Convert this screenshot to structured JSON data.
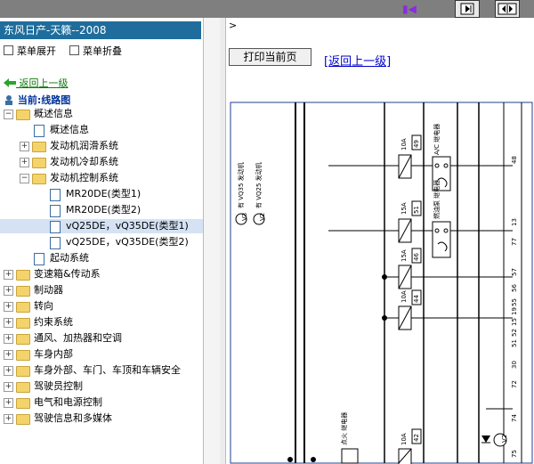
{
  "window": {
    "title": "东风日产-天籁--2008"
  },
  "menu": {
    "expand": "菜单展开",
    "collapse": "菜单折叠"
  },
  "nav": {
    "back": "返回上一级",
    "current": "当前:线路图"
  },
  "tree": [
    {
      "label": "概述信息",
      "indent": 0,
      "type": "folder",
      "expanded": true
    },
    {
      "label": "概述信息",
      "indent": 1,
      "type": "doc"
    },
    {
      "label": "发动机润滑系统",
      "indent": 1,
      "type": "folder"
    },
    {
      "label": "发动机冷却系统",
      "indent": 1,
      "type": "folder"
    },
    {
      "label": "发动机控制系统",
      "indent": 1,
      "type": "folder",
      "expanded": true
    },
    {
      "label": "MR20DE(类型1)",
      "indent": 2,
      "type": "doc"
    },
    {
      "label": "MR20DE(类型2)",
      "indent": 2,
      "type": "doc"
    },
    {
      "label": "vQ25DE，vQ35DE(类型1)",
      "indent": 2,
      "type": "doc",
      "selected": true
    },
    {
      "label": "vQ25DE，vQ35DE(类型2)",
      "indent": 2,
      "type": "doc"
    },
    {
      "label": "起动系统",
      "indent": 1,
      "type": "doc"
    },
    {
      "label": "变速箱&传动系",
      "indent": 0,
      "type": "folder"
    },
    {
      "label": "制动器",
      "indent": 0,
      "type": "folder"
    },
    {
      "label": "转向",
      "indent": 0,
      "type": "folder"
    },
    {
      "label": "约束系统",
      "indent": 0,
      "type": "folder"
    },
    {
      "label": "通风、加热器和空调",
      "indent": 0,
      "type": "folder"
    },
    {
      "label": "车身内部",
      "indent": 0,
      "type": "folder"
    },
    {
      "label": "车身外部、车门、车顶和车辆安全",
      "indent": 0,
      "type": "folder"
    },
    {
      "label": "驾驶员控制",
      "indent": 0,
      "type": "folder"
    },
    {
      "label": "电气和电源控制",
      "indent": 0,
      "type": "folder"
    },
    {
      "label": "驾驶信息和多媒体",
      "indent": 0,
      "type": "folder"
    }
  ],
  "content": {
    "breadcrumb_marker": ">",
    "print_button": "打印当前页",
    "return_link": "[返回上一级]"
  },
  "diagram": {
    "v3_tag": "V3",
    "v3_text": "有 VQ35 发动机",
    "v2_tag": "V2",
    "v2_text": "有 VQ25 发动机",
    "fuse1_amp": "10A",
    "fuse1_no": "49",
    "fuse2_amp": "15A",
    "fuse2_no": "51",
    "fuse3_amp": "15A",
    "fuse3_no": "46",
    "fuse4_amp": "10A",
    "fuse4_no": "44",
    "fuse5_amp": "10A",
    "fuse5_no": "42",
    "relay1": "A/C 继电器",
    "relay2": "燃油泵 继电器",
    "relay3": "点火 继电器",
    "pin_48": "48",
    "pin_13": "13",
    "pin_77": "77",
    "pin_57": "57",
    "pin_56": "56",
    "pin_55": "55",
    "pin_19": "19",
    "pin_15": "15",
    "pin_52": "52",
    "pin_51": "51",
    "pin_30": "30",
    "pin_72": "72",
    "pin_74": "74",
    "pin_75": "75",
    "v2_small": "V2"
  }
}
